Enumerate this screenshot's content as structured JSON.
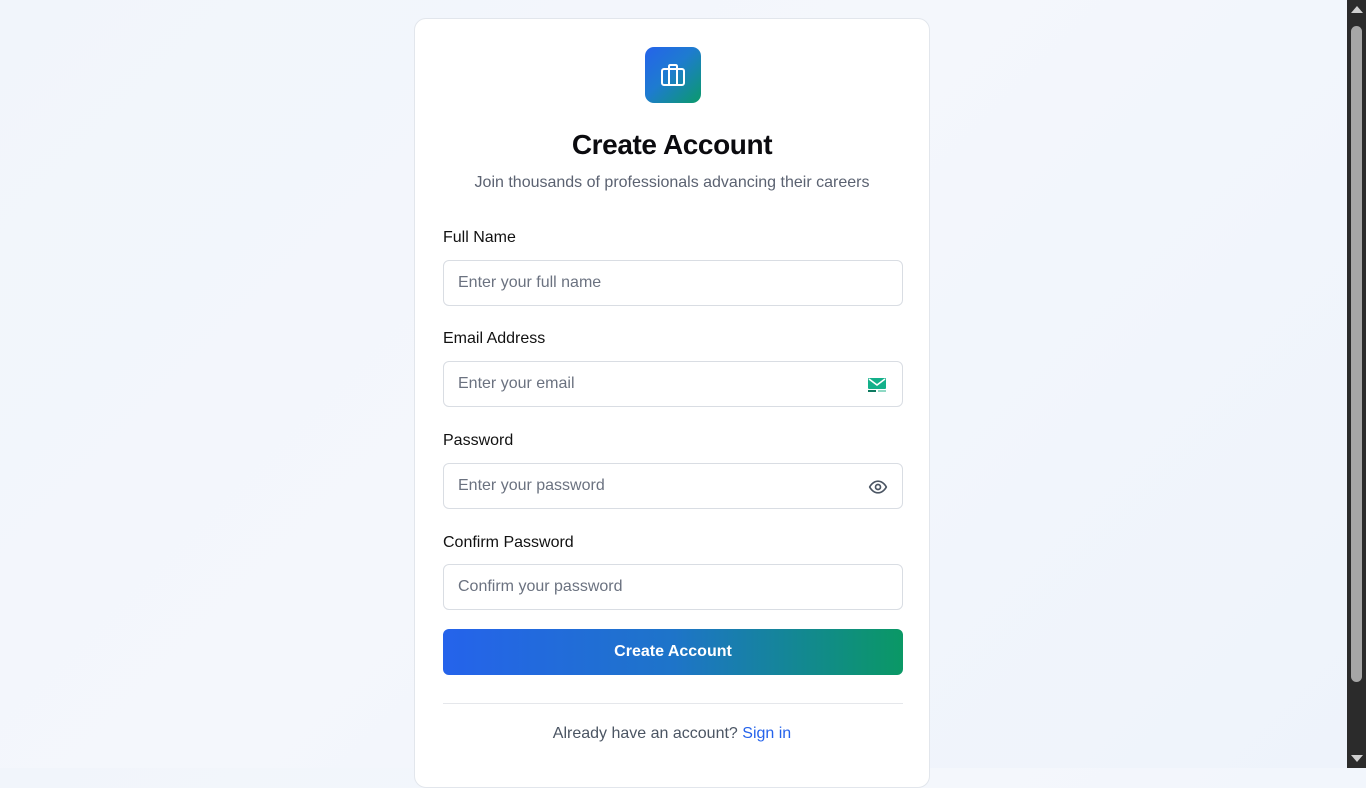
{
  "header": {
    "logo_icon": "briefcase-icon",
    "title": "Create Account",
    "subtitle": "Join thousands of professionals advancing their careers"
  },
  "form": {
    "full_name": {
      "label": "Full Name",
      "placeholder": "Enter your full name",
      "value": ""
    },
    "email": {
      "label": "Email Address",
      "placeholder": "Enter your email",
      "value": "",
      "icon": "email-autofill-icon"
    },
    "password": {
      "label": "Password",
      "placeholder": "Enter your password",
      "value": "",
      "icon": "eye-icon"
    },
    "confirm_password": {
      "label": "Confirm Password",
      "placeholder": "Confirm your password",
      "value": ""
    },
    "submit_label": "Create Account"
  },
  "footer": {
    "prompt": "Already have an account?",
    "link": "Sign in"
  },
  "colors": {
    "accent_blue": "#2563eb",
    "accent_green": "#0a9865",
    "link": "#2563eb"
  }
}
